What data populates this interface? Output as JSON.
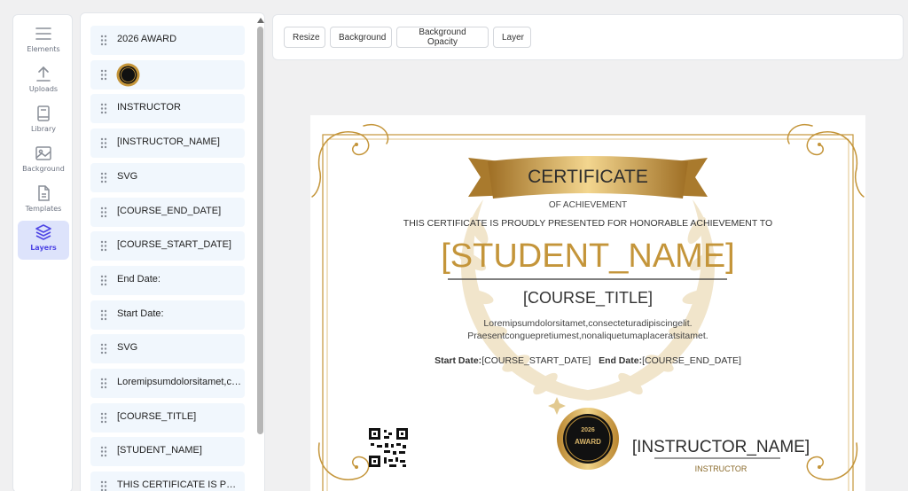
{
  "rail": {
    "items": [
      {
        "label": "Elements",
        "icon": "menu-icon"
      },
      {
        "label": "Uploads",
        "icon": "upload-icon"
      },
      {
        "label": "Library",
        "icon": "book-icon"
      },
      {
        "label": "Background",
        "icon": "image-icon"
      },
      {
        "label": "Templates",
        "icon": "template-icon"
      },
      {
        "label": "Layers",
        "icon": "layers-icon",
        "active": true
      }
    ]
  },
  "layers": {
    "items": [
      {
        "label": "2026 AWARD"
      },
      {
        "label": "",
        "thumbnail": "award-badge-thumbnail"
      },
      {
        "label": "INSTRUCTOR"
      },
      {
        "label": "[INSTRUCTOR_NAME]"
      },
      {
        "label": "SVG"
      },
      {
        "label": "[COURSE_END_DATE]"
      },
      {
        "label": "[COURSE_START_DATE]"
      },
      {
        "label": "End Date:"
      },
      {
        "label": "Start Date:"
      },
      {
        "label": "SVG"
      },
      {
        "label": "Loremipsumdolorsitamet,co..."
      },
      {
        "label": "[COURSE_TITLE]"
      },
      {
        "label": "[STUDENT_NAME]"
      },
      {
        "label": "THIS CERTIFICATE IS PROUD..."
      }
    ]
  },
  "toolbar": {
    "buttons": [
      "Resize",
      "Background",
      "Background Opacity",
      "Layer"
    ]
  },
  "certificate": {
    "banner_title": "CERTIFICATE",
    "subtitle": "OF ACHIEVEMENT",
    "presented_line": "THIS CERTIFICATE IS PROUDLY PRESENTED FOR HONORABLE ACHIEVEMENT TO",
    "student_name": "[STUDENT_NAME]",
    "course_title": "[COURSE_TITLE]",
    "description_line1": "Loremipsumdolorsitamet,consecteturadipiscingelit.",
    "description_line2": "Praesentconguepretiumest,nonaliquetumaplaceratsitamet.",
    "start_label": "Start Date:",
    "start_value": "[COURSE_START_DATE]",
    "end_label": "End Date:",
    "end_value": "[COURSE_END_DATE]",
    "badge_year": "2026",
    "badge_text": "AWARD",
    "instructor_name": "[INSTRUCTOR_NAME]",
    "instructor_role": "INSTRUCTOR"
  },
  "colors": {
    "gold": "#c4953a",
    "accent": "#4f46e5",
    "layer_bg": "#f1f7fd"
  }
}
